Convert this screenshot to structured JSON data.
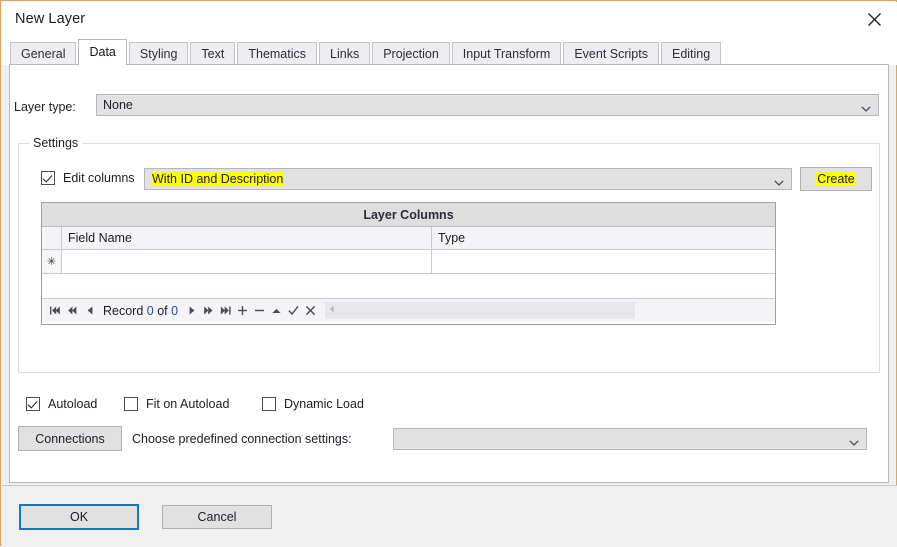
{
  "window": {
    "title": "New Layer",
    "close_icon": "close-icon"
  },
  "tabs": [
    {
      "label": "General",
      "active": false
    },
    {
      "label": "Data",
      "active": true
    },
    {
      "label": "Styling",
      "active": false
    },
    {
      "label": "Text",
      "active": false
    },
    {
      "label": "Thematics",
      "active": false
    },
    {
      "label": "Links",
      "active": false
    },
    {
      "label": "Projection",
      "active": false
    },
    {
      "label": "Input Transform",
      "active": false
    },
    {
      "label": "Event Scripts",
      "active": false
    },
    {
      "label": "Editing",
      "active": false
    }
  ],
  "data_tab": {
    "layer_type": {
      "label": "Layer type:",
      "value": "None",
      "arrow_icon": "chevron-down-icon"
    },
    "settings": {
      "title": "Settings",
      "edit_columns": {
        "label": "Edit columns",
        "checked": true,
        "combo_value": "With ID and Description",
        "highlighted": true,
        "arrow_icon": "chevron-down-icon"
      },
      "create_button": {
        "label": "Create",
        "highlighted": true
      },
      "grid": {
        "title": "Layer Columns",
        "columns": [
          "Field Name",
          "Type"
        ],
        "rows": [
          {
            "marker": "✳",
            "field_name": "",
            "type": ""
          }
        ],
        "navigator": {
          "first_icon": "first-record-icon",
          "prev_page_icon": "previous-page-icon",
          "prev_icon": "previous-record-icon",
          "text_prefix": "Record",
          "current": "0",
          "text_middle": "of",
          "total": "0",
          "next_icon": "next-record-icon",
          "next_page_icon": "next-page-icon",
          "last_icon": "last-record-icon",
          "add_icon": "add-record-icon",
          "delete_icon": "delete-record-icon",
          "edit_icon": "edit-record-icon",
          "post_icon": "post-edit-icon",
          "cancel_icon": "cancel-edit-icon",
          "scroll_icon": "scroll-left-icon"
        }
      }
    },
    "options": [
      {
        "label": "Autoload",
        "checked": true
      },
      {
        "label": "Fit on Autoload",
        "checked": false
      },
      {
        "label": "Dynamic Load",
        "checked": false
      }
    ],
    "connections": {
      "button_label": "Connections",
      "prompt": "Choose predefined connection settings:",
      "combo_value": "",
      "arrow_icon": "chevron-down-icon"
    }
  },
  "footer": {
    "ok_label": "OK",
    "cancel_label": "Cancel"
  },
  "colors": {
    "window_border": "#d8a863",
    "highlight": "#ffff00",
    "focus_border": "#0d7ac4"
  }
}
